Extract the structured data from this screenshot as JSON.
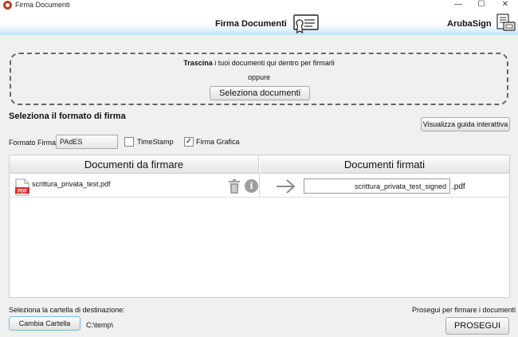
{
  "window": {
    "title": "Firma Documenti",
    "minimize": "—",
    "maximize": "☐",
    "close": "✕"
  },
  "header": {
    "title": "Firma Documenti",
    "brand": "ArubaSign"
  },
  "dropzone": {
    "text_bold": "Trascina",
    "text_rest": " i tuoi documenti qui dentro per firmarli",
    "or": "oppure",
    "select_button": "Seleziona documenti"
  },
  "format": {
    "section_title": "Seleziona il formato di firma",
    "guide_button": "Visualizza guida interattiva",
    "label": "Formato Firma:",
    "selected": "PAdES",
    "timestamp_label": "TimeStamp",
    "timestamp_checked": false,
    "graphic_label": "Firma Grafica",
    "graphic_checked": true
  },
  "table": {
    "header_left": "Documenti da firmare",
    "header_right": "Documenti firmati",
    "rows": [
      {
        "file_name": "scrittura_privata_test.pdf",
        "output_name": "scrittura_privata_test_signed",
        "output_ext": ".pdf"
      }
    ]
  },
  "footer": {
    "dest_label": "Seleziona la cartella di destinazione:",
    "change_button": "Cambia Cartella",
    "dest_path": "C:\\temp\\",
    "proceed_label": "Prosegui per firmare i documenti",
    "proceed_button": "PROSEGUI"
  },
  "icons": {
    "app": "app-icon",
    "certificate": "certificate-icon",
    "brand": "aruba-sign-icon",
    "pdf": "pdf-file-icon",
    "trash": "trash-icon",
    "info": "info-icon",
    "arrow": "arrow-right-icon"
  },
  "colors": {
    "header_gradient_end": "#b9e2f7",
    "pdf_red": "#d32f2f"
  }
}
